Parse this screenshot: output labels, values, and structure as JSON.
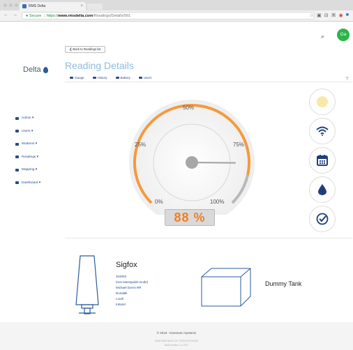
{
  "browser": {
    "tab_title": "RMS Delta",
    "url_secure_label": "Secure",
    "url_scheme": "https://",
    "url_host": "www.rmsdelta.com",
    "url_path": "/Readings/Details/991"
  },
  "header": {
    "avatar_initials": "Ga"
  },
  "brand": {
    "logo_text": "Delta"
  },
  "sidebar": {
    "items": [
      {
        "label": "Admin ▾",
        "icon": "home-icon"
      },
      {
        "label": "Users ▾",
        "icon": "user-icon"
      },
      {
        "label": "Modems ▾",
        "icon": "modem-icon"
      },
      {
        "label": "Readings ▾",
        "icon": "readings-icon"
      },
      {
        "label": "Mapping ▾",
        "icon": "map-icon"
      },
      {
        "label": "Dashboard ▾",
        "icon": "dashboard-icon"
      }
    ]
  },
  "main": {
    "back_label": "❮ Back to Readings list",
    "title": "Reading Details",
    "tabs": [
      {
        "label": "Gauge"
      },
      {
        "label": "History"
      },
      {
        "label": "Battery"
      },
      {
        "label": "Users"
      }
    ]
  },
  "gauge": {
    "tick_0": "0%",
    "tick_25": "25%",
    "tick_50": "50%",
    "tick_75": "75%",
    "tick_100": "100%",
    "value_label": "88 %",
    "value": 88
  },
  "side_buttons": [
    "light-icon",
    "signal-icon",
    "calendar-icon",
    "drop-icon",
    "check-icon"
  ],
  "sensor": {
    "name": "Sigfox",
    "lines": [
      "204603",
      "(non-waveguide-mode)",
      "Michael Dorns RR",
      "Dundalk",
      "Louth",
      "Ireland"
    ]
  },
  "tank": {
    "name": "Dummy Tank"
  },
  "footer": {
    "copyright": "© 2018 - Dunraven Systems",
    "meta_line1": "Build Date Mar10 16 / 2018 6:10:00 AM",
    "meta_line2": "Build version 1.4.3.37"
  },
  "colors": {
    "accent": "#f07f1e",
    "primary": "#2a4a8b",
    "title": "#8fbbe0",
    "avatar": "#2db34a"
  }
}
